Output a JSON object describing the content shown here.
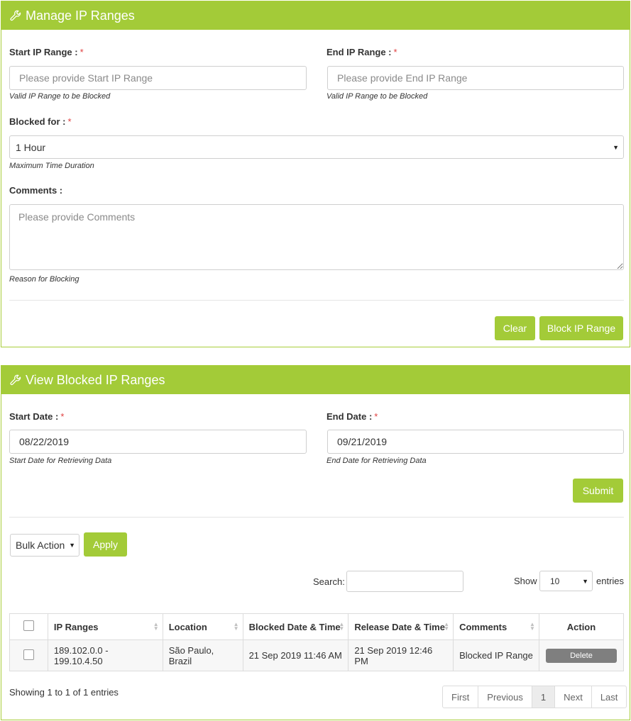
{
  "manage": {
    "title": "Manage IP Ranges",
    "start_label": "Start IP Range :",
    "start_placeholder": "Please provide Start IP Range",
    "start_help": "Valid IP Range to be Blocked",
    "end_label": "End IP Range :",
    "end_placeholder": "Please provide End IP Range",
    "end_help": "Valid IP Range to be Blocked",
    "blocked_label": "Blocked for :",
    "blocked_value": "1 Hour",
    "blocked_help": "Maximum Time Duration",
    "comments_label": "Comments :",
    "comments_placeholder": "Please provide Comments",
    "comments_help": "Reason for Blocking",
    "clear_label": "Clear",
    "block_label": "Block IP Range"
  },
  "view": {
    "title": "View Blocked IP Ranges",
    "start_date_label": "Start Date :",
    "start_date_value": "08/22/2019",
    "start_date_help": "Start Date for Retrieving Data",
    "end_date_label": "End Date :",
    "end_date_value": "09/21/2019",
    "end_date_help": "End Date for Retrieving Data",
    "submit_label": "Submit",
    "bulk_action": "Bulk Action",
    "apply_label": "Apply",
    "search_label": "Search:",
    "show_label": "Show",
    "show_value": "10",
    "entries_label": "entries",
    "columns": [
      "IP Ranges",
      "Location",
      "Blocked Date & Time",
      "Release Date & Time",
      "Comments",
      "Action"
    ],
    "rows": [
      {
        "ip": "189.102.0.0 - 199.10.4.50",
        "location": "São Paulo, Brazil",
        "blocked": "21 Sep 2019 11:46 AM",
        "release": "21 Sep 2019 12:46 PM",
        "comment": "Blocked IP Range",
        "action": "Delete"
      }
    ],
    "showing": "Showing 1 to 1 of 1 entries",
    "pager": {
      "first": "First",
      "previous": "Previous",
      "page": "1",
      "next": "Next",
      "last": "Last"
    }
  },
  "required_mark": "*",
  "colors": {
    "accent": "#a3cb38",
    "required": "#e04040",
    "delete_button": "#7f7f7f"
  }
}
